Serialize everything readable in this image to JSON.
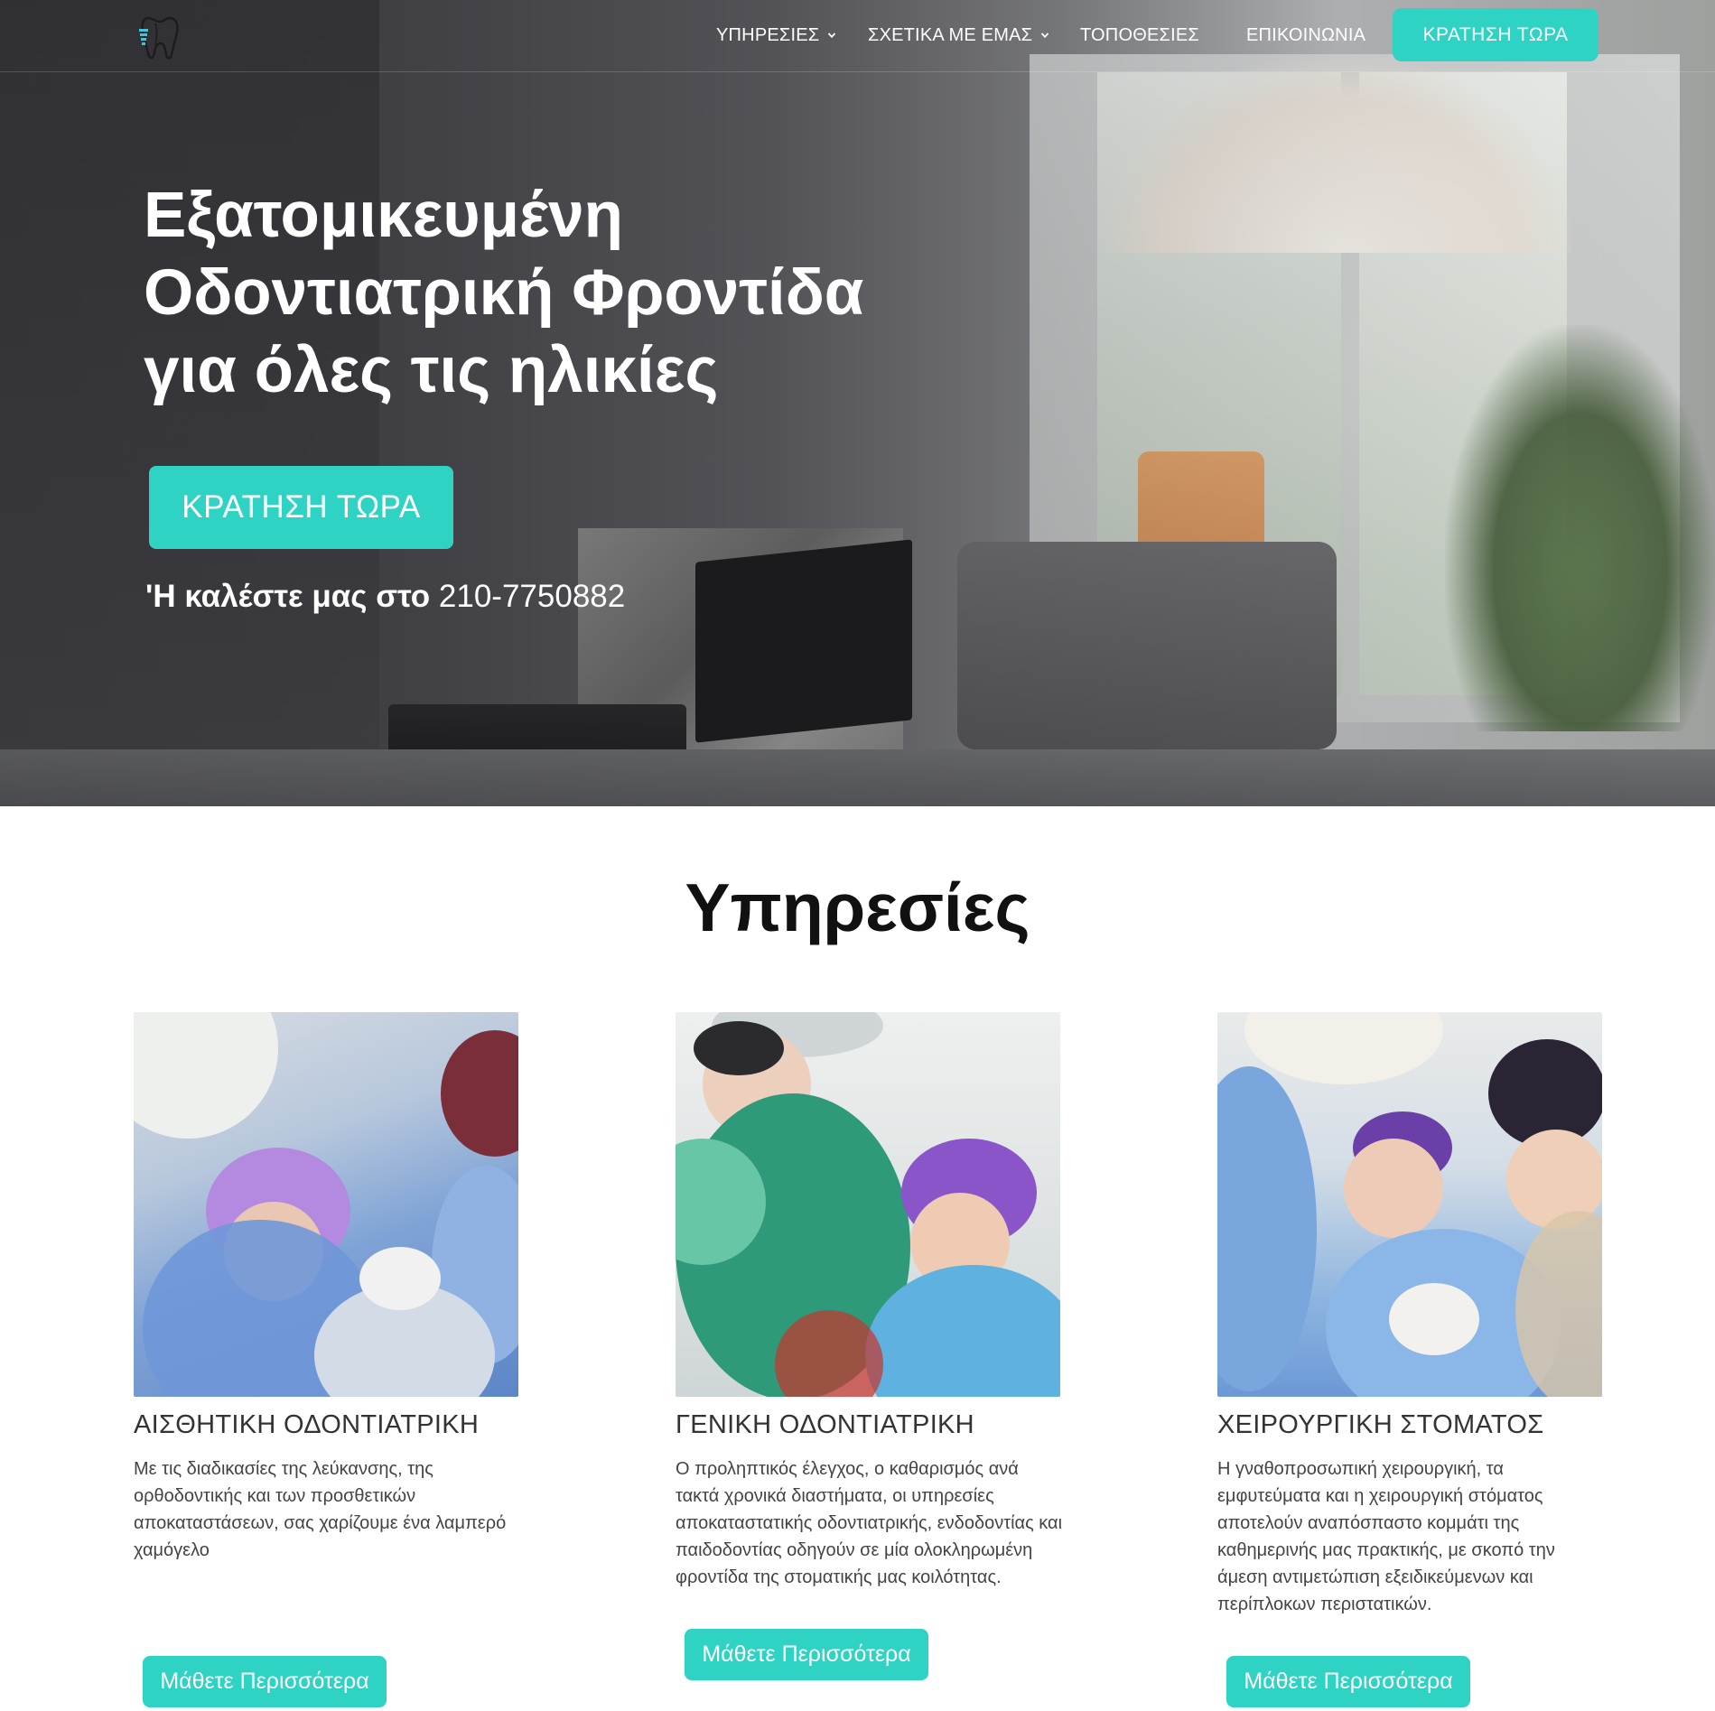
{
  "header": {
    "logo_alt": "tooth-logo",
    "nav": [
      {
        "label": "ΥΠΗΡΕΣΙΕΣ",
        "has_dropdown": true
      },
      {
        "label": "ΣΧΕΤΙΚΑ ΜΕ ΕΜΑΣ",
        "has_dropdown": true
      },
      {
        "label": "ΤΟΠΟΘΕΣΙΕΣ",
        "has_dropdown": false
      },
      {
        "label": "ΕΠΙΚΟΙΝΩΝΙΑ",
        "has_dropdown": false
      }
    ],
    "cta": "ΚΡΑΤΗΣΗ ΤΩΡΑ"
  },
  "hero": {
    "title_line1": "Εξατομικευμένη",
    "title_line2": "Οδοντιατρική Φροντίδα",
    "title_line3": "για όλες τις ηλικίες",
    "cta": "ΚΡΑΤΗΣΗ ΤΩΡΑ",
    "phone_lead": "'Η καλέστε μας στο",
    "phone_number": "210-7750882"
  },
  "services": {
    "title": "Υπηρεσίες",
    "cards": [
      {
        "title": "ΑΙΣΘΗΤΙΚΗ ΟΔΟΝΤΙΑΤΡΙΚΗ",
        "text": "Με τις διαδικασίες της λεύκανσης, της ορθοδοντικής και των προσθετικών αποκαταστάσεων, σας χαρίζουμε ένα λαμπερό χαμόγελο",
        "button": "Μάθετε Περισσότερα"
      },
      {
        "title": "ΓΕΝΙΚΗ ΟΔΟΝΤΙΑΤΡΙΚΗ",
        "text": "Ο προληπτικός έλεγχος, ο καθαρισμός ανά τακτά χρονικά διαστήματα, οι υπηρεσίες αποκαταστατικής οδοντιατρικής, ενδοδοντίας και παιδοδοντίας οδηγούν σε μία ολοκληρωμένη φροντίδα της στοματικής μας κοιλότητας.",
        "button": "Μάθετε Περισσότερα"
      },
      {
        "title": "ΧΕΙΡΟΥΡΓΙΚΗ ΣΤΟΜΑΤΟΣ",
        "text": "Η γναθοπροσωπική χειρουργική, τα εμφυτεύματα και η χειρουργική στόματος αποτελούν αναπόσπαστο κομμάτι της καθημερινής μας πρακτικής, με σκοπό την άμεση αντιμετώπιση εξειδικεύμενων και περίπλοκων περιστατικών.",
        "button": "Μάθετε Περισσότερα"
      }
    ]
  },
  "colors": {
    "accent": "#2fd3c3",
    "heading": "#111111",
    "body_text": "#444444"
  }
}
